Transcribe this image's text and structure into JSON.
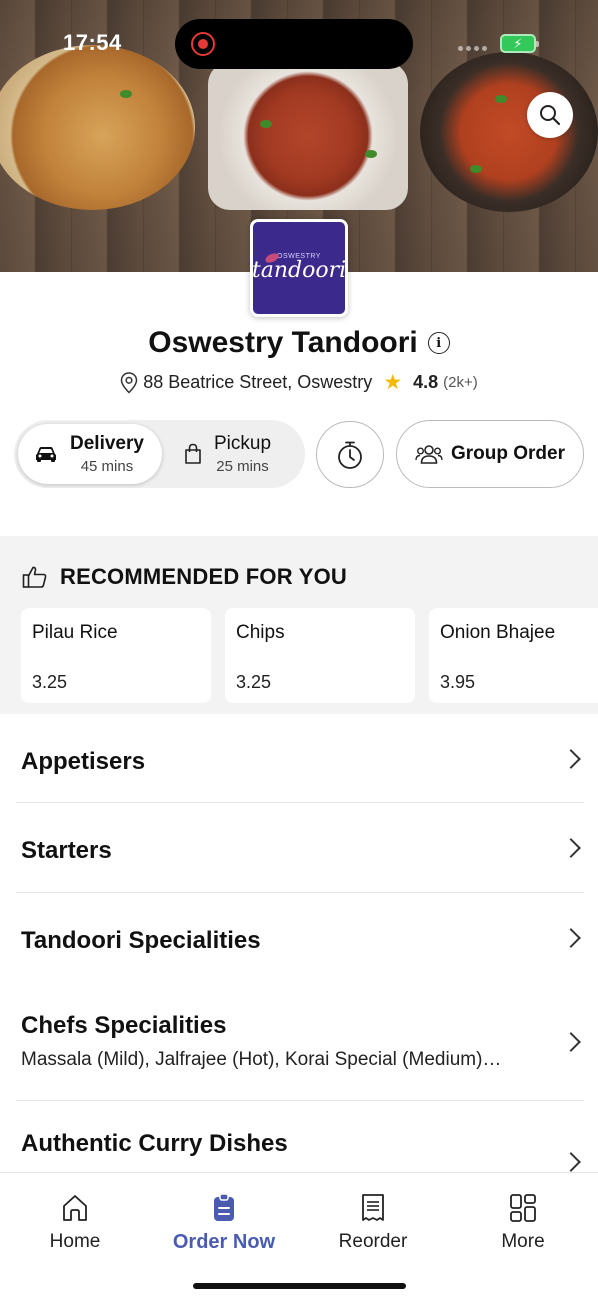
{
  "status_bar": {
    "time": "17:54"
  },
  "restaurant": {
    "logo_top_text": "OSWESTRY",
    "logo_main_text": "tandoori",
    "name": "Oswestry Tandoori",
    "address": "88 Beatrice Street, Oswestry",
    "rating": "4.8",
    "rating_count": "(2k+)"
  },
  "service": {
    "delivery": {
      "label": "Delivery",
      "time": "45 mins",
      "selected": true
    },
    "pickup": {
      "label": "Pickup",
      "time": "25 mins",
      "selected": false
    },
    "group_order_label": "Group Order"
  },
  "recommended": {
    "title": "RECOMMENDED FOR YOU",
    "items": [
      {
        "name": "Pilau Rice",
        "price": "3.25"
      },
      {
        "name": "Chips",
        "price": "3.25"
      },
      {
        "name": "Onion Bhajee",
        "price": "3.95"
      }
    ]
  },
  "categories": [
    {
      "title": "Appetisers",
      "description": ""
    },
    {
      "title": "Starters",
      "description": ""
    },
    {
      "title": "Tandoori Specialities",
      "description": ""
    },
    {
      "title": "Chefs Specialities",
      "description": "Massala (Mild), Jalfrajee (Hot), Korai Special (Medium)…"
    },
    {
      "title": "Authentic Curry Dishes",
      "description": ""
    }
  ],
  "bottom_nav": {
    "items": [
      {
        "label": "Home",
        "icon": "home-icon"
      },
      {
        "label": "Order Now",
        "icon": "order-icon",
        "active": true
      },
      {
        "label": "Reorder",
        "icon": "receipt-icon"
      },
      {
        "label": "More",
        "icon": "grid-icon"
      }
    ]
  },
  "colors": {
    "accent": "#4a5bb0",
    "logo_bg": "#3b2a8c",
    "star": "#f5b800",
    "battery": "#34c759",
    "record": "#e53935"
  }
}
